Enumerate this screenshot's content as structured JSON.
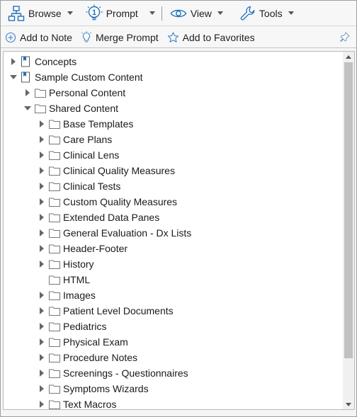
{
  "menubar": {
    "browse": {
      "label": "Browse",
      "icon": "sitemap-icon"
    },
    "prompt": {
      "label": "Prompt",
      "icon": "prompt-bulb-icon",
      "badge": "1"
    },
    "view": {
      "label": "View",
      "icon": "eye-icon"
    },
    "tools": {
      "label": "Tools",
      "icon": "wrench-icon"
    }
  },
  "actions": {
    "add_to_note": "Add to Note",
    "merge_prompt": "Merge Prompt",
    "add_to_favorites": "Add to Favorites"
  },
  "colors": {
    "accent_blue": "#1e6fb8",
    "folder_stroke": "#777777",
    "thumb": "#c1c1c1"
  },
  "tree": {
    "concepts": "Concepts",
    "sample_custom": "Sample Custom Content",
    "personal": "Personal Content",
    "shared": "Shared Content",
    "shared_items": [
      "Base Templates",
      "Care Plans",
      "Clinical Lens",
      "Clinical Quality Measures",
      "Clinical Tests",
      "Custom Quality Measures",
      "Extended Data Panes",
      "General Evaluation - Dx Lists",
      "Header-Footer",
      "History",
      "HTML",
      "Images",
      "Patient Level Documents",
      "Pediatrics",
      "Physical Exam",
      "Procedure Notes",
      "Screenings - Questionnaires",
      "Symptoms Wizards",
      "Text Macros"
    ]
  }
}
